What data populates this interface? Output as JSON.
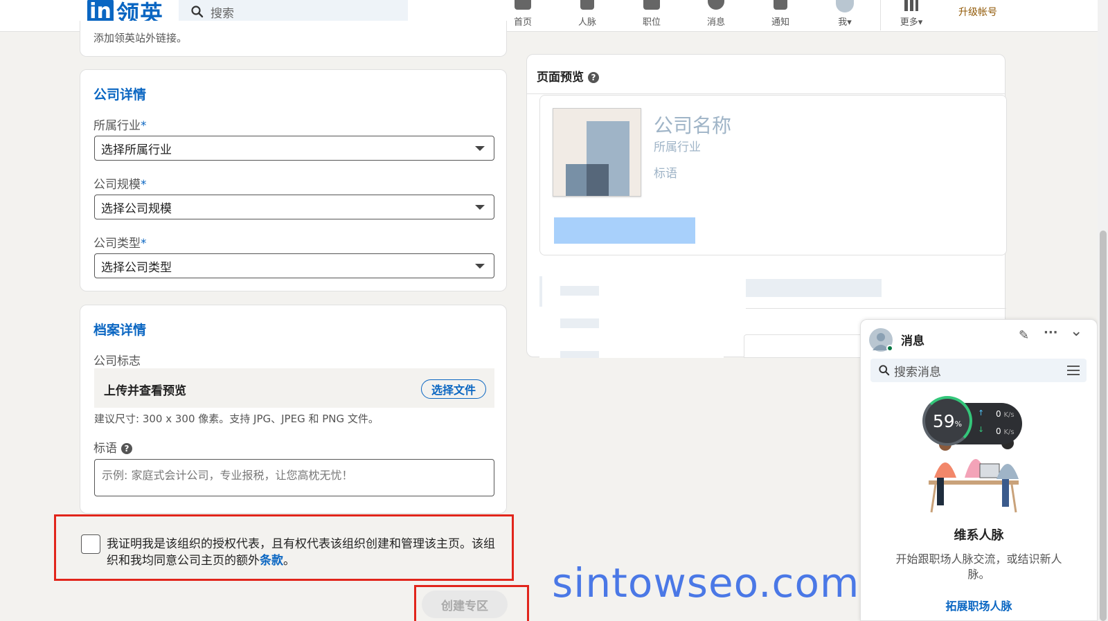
{
  "nav": {
    "logo_in": "in",
    "logo_text": "领英",
    "search_placeholder": "搜索",
    "items": [
      {
        "label": "首页"
      },
      {
        "label": "人脉"
      },
      {
        "label": "职位"
      },
      {
        "label": "消息"
      },
      {
        "label": "通知"
      },
      {
        "label": "我▾"
      },
      {
        "label": "更多▾"
      }
    ],
    "upgrade": "升级帐号"
  },
  "top_card": {
    "external_link_hint": "添加领英站外链接。"
  },
  "company_details": {
    "title": "公司详情",
    "industry_label": "所属行业",
    "industry_value": "选择所属行业",
    "size_label": "公司规模",
    "size_value": "选择公司规模",
    "type_label": "公司类型",
    "type_value": "选择公司类型",
    "required_mark": "*"
  },
  "profile_details": {
    "title": "档案详情",
    "logo_label": "公司标志",
    "upload_text": "上传并查看预览",
    "upload_button": "选择文件",
    "size_hint": "建议尺寸: 300 x 300 像素。支持 JPG、JPEG 和 PNG 文件。",
    "tagline_label": "标语",
    "help_glyph": "?",
    "tagline_placeholder": "示例: 家庭式会计公司，专业报税，让您高枕无忧！"
  },
  "agreement": {
    "text": "我证明我是该组织的授权代表，且有权代表该组织创建和管理该主页。该组织和我均同意公司主页的额外",
    "link": "条款",
    "end": "。"
  },
  "create_button": "创建专区",
  "preview": {
    "title": "页面预览",
    "company_name": "公司名称",
    "industry": "所属行业",
    "tagline": "标语"
  },
  "messaging": {
    "title": "消息",
    "search_placeholder": "搜索消息",
    "compose_glyph": "✎",
    "more_glyph": "···",
    "collapse_glyph": "⌄",
    "headline": "维系人脉",
    "description": "开始跟职场人脉交流，或结识新人脉。",
    "link": "拓展职场人脉"
  },
  "speed_widget": {
    "percent": "59",
    "percent_sign": "%",
    "up": "0",
    "down": "0",
    "unit": "K/s",
    "up_arrow": "↑",
    "down_arrow": "↓"
  },
  "watermark": "sintowseo.com",
  "colors": {
    "brand": "#0a66c2",
    "highlight_box": "#e1251b",
    "watermark": "#4a78e6"
  }
}
